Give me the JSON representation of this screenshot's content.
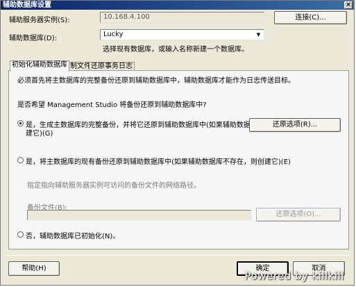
{
  "window": {
    "title": "辅助数据库设置",
    "close_glyph": "×"
  },
  "server": {
    "label": "辅助服务器实例(S):",
    "value": "10.168.4.100",
    "connect_button": "连接(C)..."
  },
  "database": {
    "label": "辅助数据库(D):",
    "value": "Lucky",
    "hint": "选择现有数据库，或输入名称新建一个数据库。"
  },
  "tabs": [
    {
      "label": "初始化辅助数据库",
      "active": true
    },
    {
      "label": "复制文件",
      "active": false
    },
    {
      "label": "还原事务日志",
      "active": false
    }
  ],
  "init_tab": {
    "intro": "必须首先将主数据库的完整备份还原到辅助数据库中，辅助数据库才能作为日志传送目标。",
    "question": "是否希望 Management Studio 将备份还原到辅助数据库中?",
    "option_full_backup": {
      "line1": "是，生成主数据库的完整备份，并将它还原到辅助数据库中(如果辅助数据库不存在，则创",
      "line2": "建它)(G)",
      "selected": true,
      "restore_button": "还原选项(R)..."
    },
    "option_existing_backup": {
      "text": "是，将主数据库的现有备份还原到辅助数据库中(如果辅助数据库不存在，则创建它)(E)",
      "selected": false,
      "path_hint": "指定指向辅助服务器实例可访问的备份文件的网络路径。",
      "backup_file_label": "备份文件(B):",
      "backup_file_value": "",
      "restore_button": "还原选项(O)..."
    },
    "option_no": {
      "text": "否，辅助数据库已初始化(N)。",
      "selected": false
    }
  },
  "footer": {
    "help_button": "帮助(H)",
    "ok_button": "确定",
    "cancel_button": "取消"
  },
  "watermark": "Powered by killkill",
  "colors": {
    "title_bar": "#0a246a",
    "dialog_bg": "#ece9d8"
  }
}
